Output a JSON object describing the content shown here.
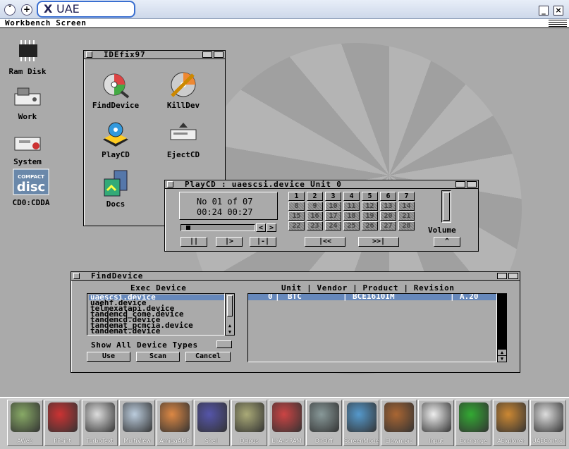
{
  "app": {
    "title": "UAE",
    "screen_title": "Workbench Screen"
  },
  "desktop_icons": [
    {
      "label": "Ram Disk",
      "icon": "ram-chip-icon"
    },
    {
      "label": "Work",
      "icon": "harddisk-icon"
    },
    {
      "label": "System",
      "icon": "system-disk-icon"
    },
    {
      "label": "CD0:CDDA",
      "icon": "compact-disc-icon"
    }
  ],
  "idefix": {
    "title": "IDEfix97",
    "items": [
      {
        "label": "FindDevice",
        "icon": "magnifier-cd-icon"
      },
      {
        "label": "KillDev",
        "icon": "broken-cd-icon"
      },
      {
        "label": "PlayCD",
        "icon": "cd-player-icon"
      },
      {
        "label": "EjectCD",
        "icon": "cd-drive-icon"
      },
      {
        "label": "Docs",
        "icon": "docs-icon"
      }
    ]
  },
  "playcd": {
    "title": "PlayCD : uaescsi.device Unit 0",
    "track_line": "No 01 of 07",
    "time_line": "00:24 00:27",
    "tracks": [
      "1",
      "2",
      "3",
      "4",
      "5",
      "6",
      "7",
      "8",
      "9",
      "10",
      "11",
      "12",
      "13",
      "14",
      "15",
      "16",
      "17",
      "18",
      "19",
      "20",
      "21",
      "22",
      "23",
      "24",
      "25",
      "26",
      "27",
      "28"
    ],
    "pause_label": "||",
    "play_label": "|>",
    "stop_label": "|-|",
    "prev_label": "|<<",
    "next_label": ">>|",
    "back_label": "<",
    "fwd_label": ">",
    "volume_label": "Volume",
    "eject_label": "^",
    "progress": 0.05
  },
  "finddevice": {
    "title": "FindDevice",
    "exec_header": "Exec Device",
    "devices": [
      "uaescsi.device",
      "uaehf.device",
      "telmexatapi.device",
      "tandemcd_come.device",
      "tandemcd.device",
      "tandemat_pcmcia.device",
      "tandemat.device"
    ],
    "table_header": "Unit | Vendor | Product | Revision",
    "rows": [
      {
        "unit": "0",
        "vendor": "BTC",
        "product": "BCE1610IM",
        "revision": "A.20"
      }
    ],
    "show_all_label": "Show All Device Types",
    "use_label": "Use",
    "scan_label": "Scan",
    "cancel_label": "Cancel"
  },
  "dock": [
    {
      "label": "AWeb",
      "icon": "web-icon"
    },
    {
      "label": "PPaint",
      "icon": "paint-icon"
    },
    {
      "label": "TurboText",
      "icon": "text-editor-icon"
    },
    {
      "label": "MultiView",
      "icon": "magnifier-icon"
    },
    {
      "label": "AmigaAMP",
      "icon": "amp-icon"
    },
    {
      "label": "Shell",
      "icon": "shell-icon"
    },
    {
      "label": "DOpus",
      "icon": "dopus-icon"
    },
    {
      "label": "LhA->RAM",
      "icon": "archive-icon"
    },
    {
      "label": "DirDiff",
      "icon": "dirdiff-icon"
    },
    {
      "label": "ScreenMode",
      "icon": "monitor-icon"
    },
    {
      "label": "Clown.pic",
      "icon": "picture-icon"
    },
    {
      "label": "Input",
      "icon": "mouse-icon"
    },
    {
      "label": "Exchange",
      "icon": "exchange-icon"
    },
    {
      "label": "AExplorer",
      "icon": "explorer-icon"
    },
    {
      "label": "UAEControl",
      "icon": "uae-control-icon"
    }
  ]
}
